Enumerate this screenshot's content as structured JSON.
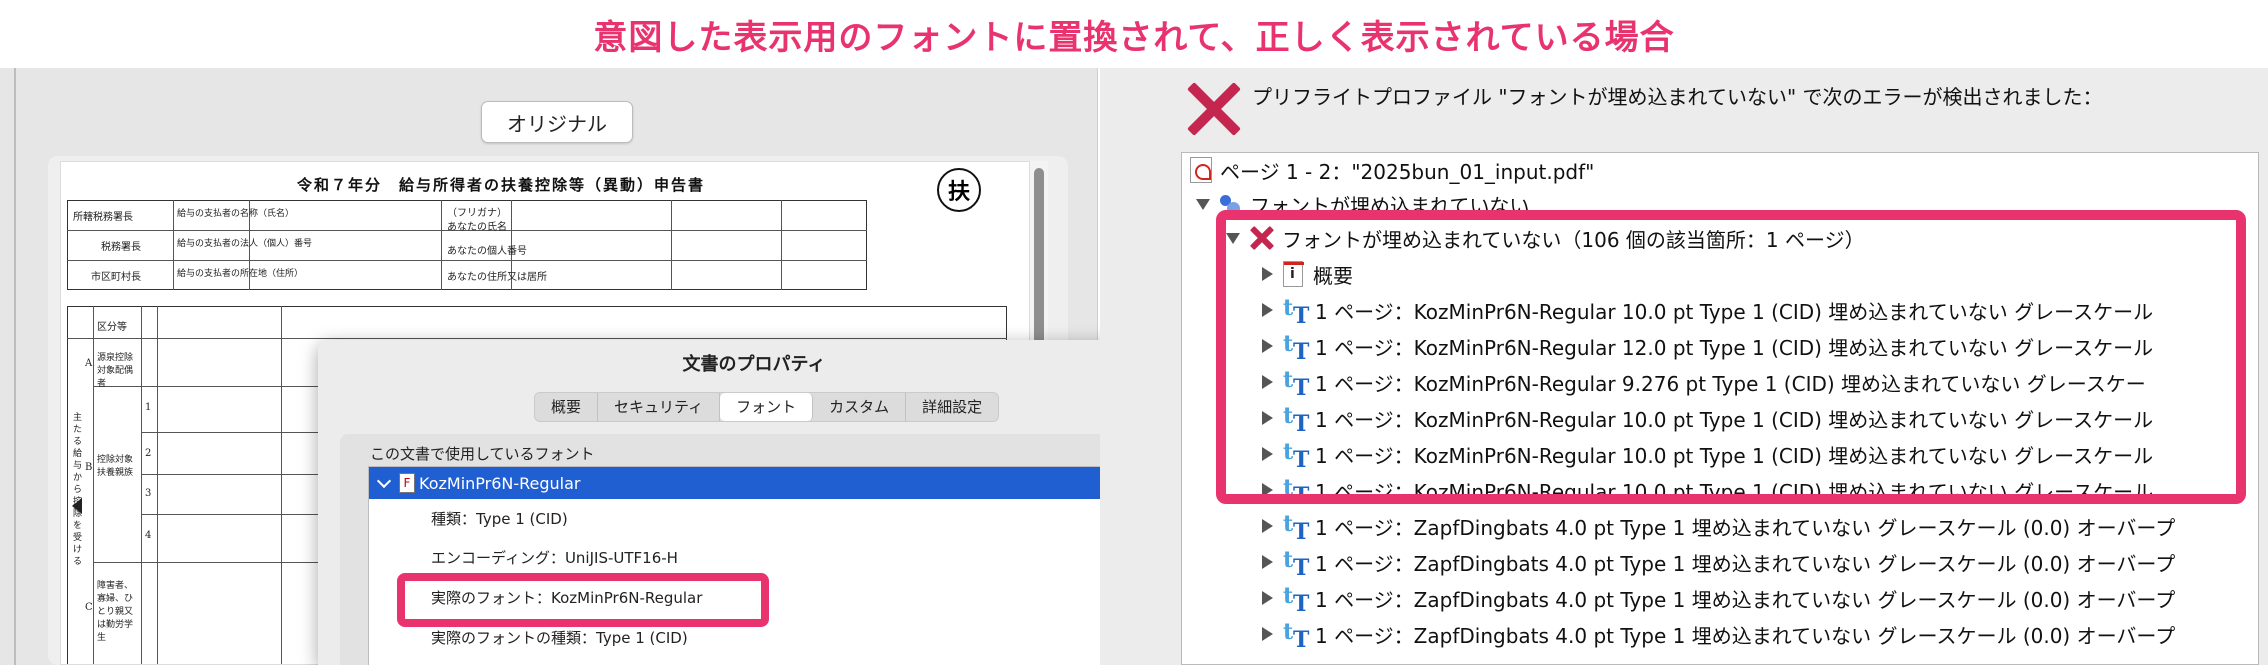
{
  "banner": {
    "text": "意図した表示用のフォントに置換されて、正しく表示されている場合"
  },
  "left_pane": {
    "original_button": "オリジナル",
    "form": {
      "title": "令和７年分　給与所得者の扶養控除等（異動）申告書",
      "seal": "扶",
      "labels": [
        "所轄税務署長",
        "税務署長",
        "市区町村長",
        "給与の支払者の名称（氏名）",
        "給与の支払者の法人（個人）番号",
        "給与の支払者の所在地（住所）",
        "（フリガナ）",
        "あなたの氏名",
        "あなたの個人番号",
        "あなたの住所又は居所",
        "区分等",
        "源泉控除対象配偶者",
        "控除対象扶養親族",
        "障害者、寡婦、ひとり親又は勤労学生",
        "主たる給与から控除を受ける",
        "1",
        "2",
        "3",
        "4",
        "A",
        "B",
        "C"
      ]
    }
  },
  "dialog": {
    "title": "文書のプロパティ",
    "tabs": [
      "概要",
      "セキュリティ",
      "フォント",
      "カスタム",
      "詳細設定"
    ],
    "active_tab": "フォント",
    "section_label": "この文書で使用しているフォント",
    "font_name": "KozMinPr6N-Regular",
    "rows": [
      "種類：Type 1 (CID)",
      "エンコーディング：UniJIS-UTF16-H",
      "実際のフォント：KozMinPr6N-Regular",
      "実際のフォントの種類：Type 1 (CID)"
    ]
  },
  "preflight": {
    "message": "プリフライトプロファイル \"フォントが埋め込まれていない\" で次のエラーが検出されました：",
    "tree": [
      {
        "label": "ページ 1 - 2：\"2025bun_01_input.pdf\"",
        "icon": "pdf-icon"
      },
      {
        "label": "フォントが埋め込まれていない",
        "icon": "group-icon"
      },
      {
        "label": "フォントが埋め込まれていない（106 個の該当箇所：1 ページ）",
        "icon": "error-icon"
      },
      {
        "label": "概要",
        "icon": "info-icon"
      },
      {
        "label": "1 ページ：KozMinPr6N-Regular 10.0 pt Type 1 (CID) 埋め込まれていない グレースケール",
        "icon": "font-icon"
      },
      {
        "label": "1 ページ：KozMinPr6N-Regular 12.0 pt Type 1 (CID) 埋め込まれていない グレースケール",
        "icon": "font-icon"
      },
      {
        "label": "1 ページ：KozMinPr6N-Regular 9.276 pt Type 1 (CID) 埋め込まれていない グレースケー",
        "icon": "font-icon"
      },
      {
        "label": "1 ページ：KozMinPr6N-Regular 10.0 pt Type 1 (CID) 埋め込まれていない グレースケール",
        "icon": "font-icon"
      },
      {
        "label": "1 ページ：KozMinPr6N-Regular 10.0 pt Type 1 (CID) 埋め込まれていない グレースケール",
        "icon": "font-icon"
      },
      {
        "label": "1 ページ：KozMinPr6N-Regular 10.0 pt Type 1 (CID) 埋め込まれていない グレースケール",
        "icon": "font-icon"
      },
      {
        "label": "1 ページ：ZapfDingbats 4.0 pt Type 1 埋め込まれていない グレースケール (0.0) オーバープ",
        "icon": "font-icon"
      },
      {
        "label": "1 ページ：ZapfDingbats 4.0 pt Type 1 埋め込まれていない グレースケール (0.0) オーバープ",
        "icon": "font-icon"
      },
      {
        "label": "1 ページ：ZapfDingbats 4.0 pt Type 1 埋め込まれていない グレースケール (0.0) オーバープ",
        "icon": "font-icon"
      },
      {
        "label": "1 ページ：ZapfDingbats 4.0 pt Type 1 埋め込まれていない グレースケール (0.0) オーバープ",
        "icon": "font-icon"
      }
    ]
  },
  "colors": {
    "highlight": "#e8336f",
    "error": "#c4264f",
    "selection": "#1f5fd1"
  }
}
